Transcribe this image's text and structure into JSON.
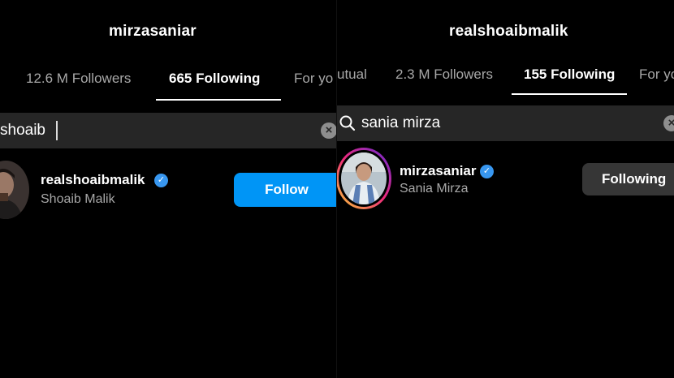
{
  "left": {
    "title": "mirzasaniar",
    "tabs": [
      {
        "label": "12.6 M Followers"
      },
      {
        "label": "665 Following"
      },
      {
        "label": "For yo"
      }
    ],
    "search": {
      "value": "shoaib"
    },
    "result": {
      "username": "realshoaibmalik",
      "fullname": "Shoaib Malik",
      "button_label": "Follow"
    }
  },
  "right": {
    "title": "realshoaibmalik",
    "tabs": [
      {
        "label": "utual"
      },
      {
        "label": "2.3 M Followers"
      },
      {
        "label": "155 Following"
      },
      {
        "label": "For yo"
      }
    ],
    "search": {
      "value": "sania mirza"
    },
    "result": {
      "username": "mirzasaniar",
      "fullname": "Sania Mirza",
      "button_label": "Following"
    }
  },
  "icons": {
    "verified": "verified-badge-icon",
    "search": "search-icon",
    "clear": "clear-icon"
  },
  "colors": {
    "background": "#000000",
    "follow_button": "#0095f6",
    "following_button": "#363636",
    "verified": "#3897f0",
    "story_ring": [
      "#f9ce34",
      "#ee2a7b",
      "#6228d7"
    ]
  }
}
